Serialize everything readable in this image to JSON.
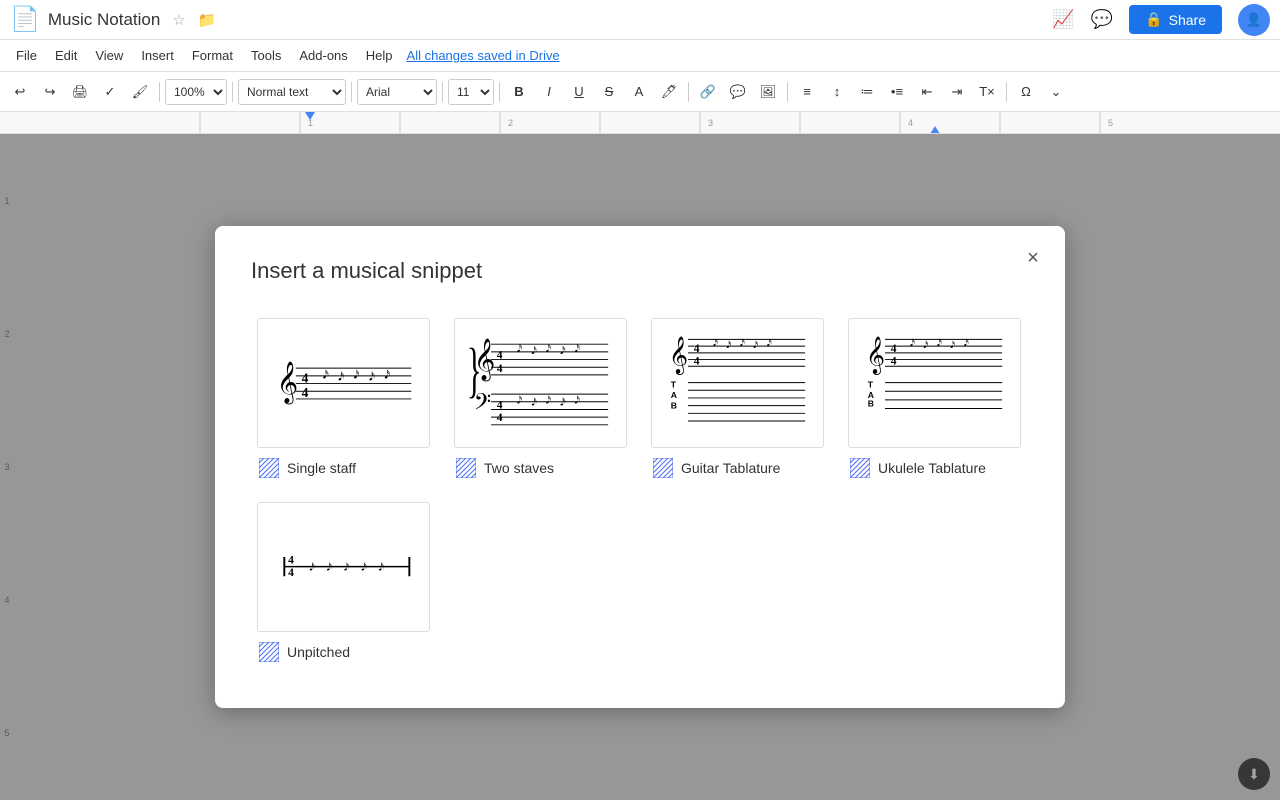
{
  "app": {
    "title": "Music Notation",
    "saved_text": "All changes saved in Drive"
  },
  "toolbar": {
    "zoom": "100%",
    "style": "Normal text",
    "font": "Arial",
    "size": "11",
    "bold": "B",
    "italic": "I",
    "underline": "U"
  },
  "menubar": {
    "items": [
      "File",
      "Edit",
      "View",
      "Insert",
      "Format",
      "Tools",
      "Add-ons",
      "Help"
    ],
    "saved_link": "All changes saved in Drive"
  },
  "dialog": {
    "title": "Insert a musical snippet",
    "close_label": "×",
    "snippets": [
      {
        "id": "single-staff",
        "label": "Single staff"
      },
      {
        "id": "two-staves",
        "label": "Two staves"
      },
      {
        "id": "guitar-tab",
        "label": "Guitar Tablature"
      },
      {
        "id": "ukulele-tab",
        "label": "Ukulele Tablature"
      },
      {
        "id": "unpitched",
        "label": "Unpitched"
      }
    ]
  }
}
